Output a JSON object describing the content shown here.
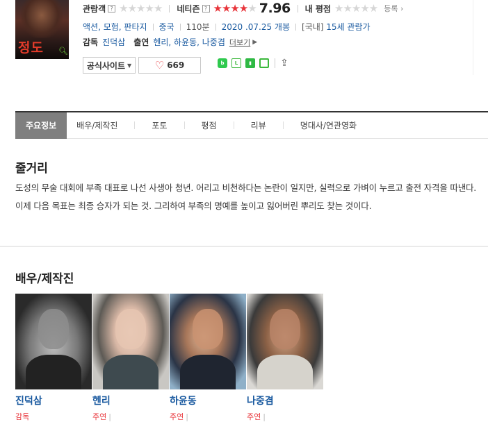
{
  "poster": {
    "title_text": "정도"
  },
  "ratings": {
    "audience_label": "관람객",
    "netizen_label": "네티즌",
    "netizen_score": "7.96",
    "my_rating_label": "내 평점",
    "register_label": "등록",
    "question_mark": "?",
    "colors": {
      "star_on": "#e8343a",
      "star_off": "#d6d6d6"
    },
    "netizen_stars": 4
  },
  "info": {
    "genre": "액션, 모험, 판타지",
    "country": "중국",
    "runtime": "110분",
    "release": "2020 .07.25 개봉",
    "rating_prefix": "[국내]",
    "rating": "15세 관람가",
    "director_label": "감독",
    "director": "진덕삼",
    "cast_label": "출연",
    "cast": "헨리, 하윤동, 나중겸",
    "more_label": "더보기"
  },
  "buttons": {
    "official_site": "공식사이트",
    "like_count": "669"
  },
  "tabs": [
    "주요정보",
    "배우/제작진",
    "포토",
    "평점",
    "리뷰",
    "명대사/연관영화"
  ],
  "synopsis": {
    "heading": "줄거리",
    "text": "도성의 무술 대회에 부족 대표로 나선 사생아 청년. 어리고 비천하다는 논란이 일지만, 실력으로 가벼이 누르고 출전 자격을 따낸다. 이제 다음 목표는 최종 승자가 되는 것. 그리하여 부족의 명예를 높이고 잃어버린 뿌리도 찾는 것이다."
  },
  "cast_section": {
    "heading": "배우/제작진",
    "people": [
      {
        "name": "진덕삼",
        "role": "감독"
      },
      {
        "name": "헨리",
        "role": "주연"
      },
      {
        "name": "하윤동",
        "role": "주연"
      },
      {
        "name": "나중겸",
        "role": "주연"
      }
    ]
  }
}
